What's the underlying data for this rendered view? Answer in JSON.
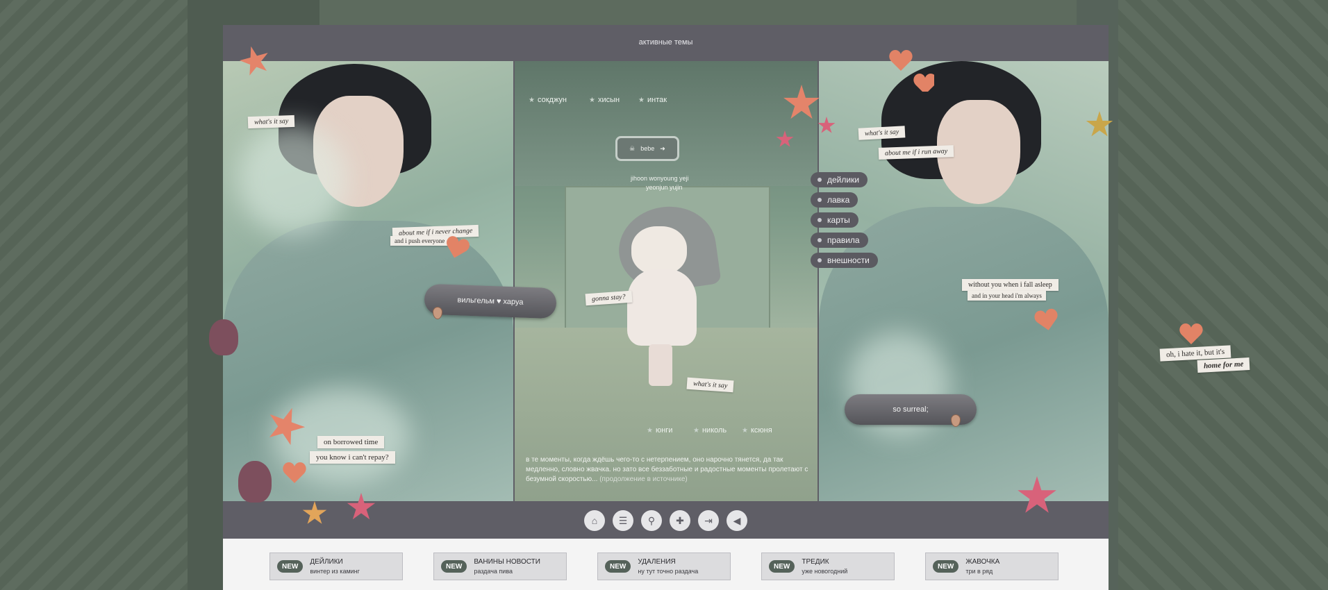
{
  "header": {
    "title": "активные темы"
  },
  "mid": {
    "tags_top": [
      "сокджун",
      "хисын",
      "интак"
    ],
    "badge_icon": "skull-crossbones-icon",
    "badge_arrow": "arrow-right-icon",
    "badge_label": "bebe",
    "names_row1": "jihoon    wonyoung    yeji",
    "names_row2": "yeonjun    yujin",
    "tags_bottom": [
      "юнги",
      "николь",
      "ксюня"
    ],
    "excerpt": "в те моменты, когда ждёшь чего-то с нетерпением, оно нарочно тянется, да так медленно, словно жвачка. но зато все беззаботные и радостные моменты пролетают с безумной скоростью...",
    "excerpt_link": "(продолжение в источнике)"
  },
  "notes": {
    "left_1": "what's it say",
    "left_2": "about me if i never change",
    "left_3": "and i push everyone",
    "left_4": "on borrowed time",
    "left_5": "you know i can't repay?",
    "mid_1": "gonna stay?",
    "mid_2": "what's it say",
    "right_1": "what's it say",
    "right_2": "about me if i run away",
    "right_3": "without you when i fall asleep",
    "right_4": "and in your head i'm always",
    "outside_1": "oh, i hate it, but it's",
    "outside_2": "home for me"
  },
  "bandages": {
    "left": "вильгельм ♥ харуа",
    "right": "so surreal;"
  },
  "menu": [
    "дейлики",
    "лавка",
    "карты",
    "правила",
    "внешности"
  ],
  "toolbar": {
    "icons": [
      "home-icon",
      "list-icon",
      "search-icon",
      "add-user-icon",
      "login-icon",
      "megaphone-icon"
    ]
  },
  "news": [
    {
      "tag": "NEW",
      "title": "ДЕЙЛИКИ",
      "sub": "винтер из каминг"
    },
    {
      "tag": "NEW",
      "title": "ВАНИНЫ НОВОСТИ",
      "sub": "раздача пива"
    },
    {
      "tag": "NEW",
      "title": "УДАЛЕНИЯ",
      "sub": "ну тут точно раздача"
    },
    {
      "tag": "NEW",
      "title": "ТРЕДИК",
      "sub": "уже новогодний"
    },
    {
      "tag": "NEW",
      "title": "ЖАВОЧКА",
      "sub": "три в ряд"
    }
  ],
  "colors": {
    "board": "#5f5e66",
    "accent_green": "#55625a",
    "background": "#5d6b5e"
  }
}
